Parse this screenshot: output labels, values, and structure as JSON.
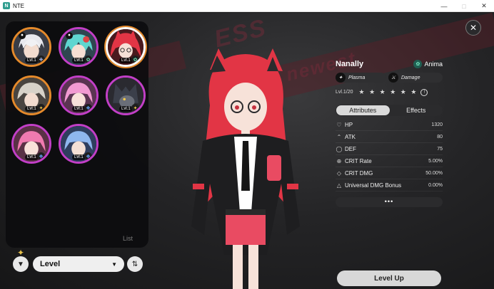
{
  "window": {
    "title": "NTE",
    "icon": "app-icon",
    "controls": [
      "minimize-icon",
      "maximize-icon",
      "close-icon"
    ]
  },
  "roster": {
    "list_label": "List",
    "characters": [
      {
        "level": "Lvl.1",
        "border": "orange",
        "element": "cross-icon",
        "badge": "bell-icon"
      },
      {
        "level": "Lvl.1",
        "border": "purple",
        "element": "leaf-icon",
        "badge": "bell-icon"
      },
      {
        "level": "Lvl.1",
        "border": "orange",
        "element": "leaf-icon",
        "selected": true
      },
      {
        "level": "Lvl.1",
        "border": "orange",
        "element": "star-icon"
      },
      {
        "level": "Lvl.1",
        "border": "purple",
        "element": "drop-icon"
      },
      {
        "level": "Lvl.1",
        "border": "purple",
        "element": "star-icon"
      },
      {
        "level": "Lvl.1",
        "border": "purple",
        "element": "drop-icon"
      },
      {
        "level": "Lvl.1",
        "border": "purple",
        "element": "drop-icon"
      }
    ]
  },
  "sort": {
    "filter_icon": "filter-icon",
    "selected": "Level",
    "order_icon": "sort-order-icon"
  },
  "character": {
    "name": "Nanally",
    "faction": "Anima",
    "tags": [
      "Plasma",
      "Damage"
    ],
    "level_text": "Lvl.1/20",
    "stars": "★ ★ ★ ★ ★ ★"
  },
  "tabs": [
    "Attributes",
    "Effects"
  ],
  "attributes": [
    {
      "icon": "heart-icon",
      "name": "HP",
      "value": "1320"
    },
    {
      "icon": "sword-icon",
      "name": "ATK",
      "value": "80"
    },
    {
      "icon": "shield-icon",
      "name": "DEF",
      "value": "75"
    },
    {
      "icon": "crosshair-icon",
      "name": "CRIT Rate",
      "value": "5.00%"
    },
    {
      "icon": "diamond-icon",
      "name": "CRIT DMG",
      "value": "50.00%"
    },
    {
      "icon": "triangle-icon",
      "name": "Universal DMG Bonus",
      "value": "0.00%"
    }
  ],
  "more": "•••",
  "level_up": "Level Up",
  "colors": {
    "orange_border": "#e58a2b",
    "purple_border": "#c23fc7",
    "hair": "#e23545",
    "wall_accent": "#7a2a3a"
  }
}
